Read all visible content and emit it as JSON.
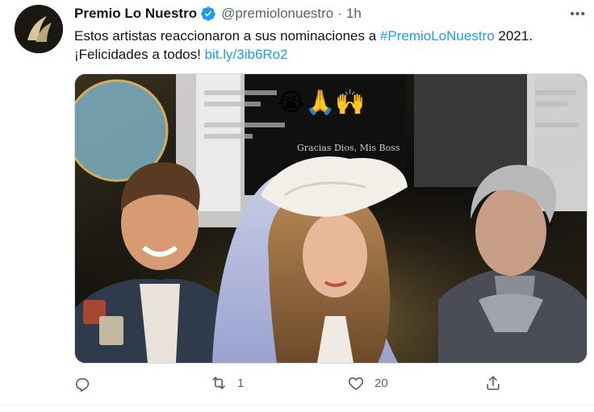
{
  "tweet": {
    "author_name": "Premio Lo Nuestro",
    "handle": "@premiolonuestro",
    "separator": "·",
    "time": "1h",
    "more_label": "•••",
    "text_line1_prefix": "Estos artistas reaccionaron a sus nominaciones a ",
    "hashtag": "#PremioLoNuestro",
    "text_line1_suffix": " 2021.",
    "text_line2_prefix": "¡Felicidades a todos! ",
    "link": "bit.ly/3ib6Ro2",
    "media": {
      "caption_overlay": "Gracias Dios, Mis Boss",
      "emojis": "😭🙏🙌"
    },
    "actions": {
      "reply_count": "",
      "retweet_count": "1",
      "like_count": "20",
      "share_count": ""
    }
  },
  "colors": {
    "accent": "#1d9bf0",
    "secondary_text": "#536471",
    "verified": "#1d9bf0"
  },
  "icons": [
    "reply-icon",
    "retweet-icon",
    "like-icon",
    "share-icon",
    "verified-badge-icon",
    "more-icon"
  ]
}
